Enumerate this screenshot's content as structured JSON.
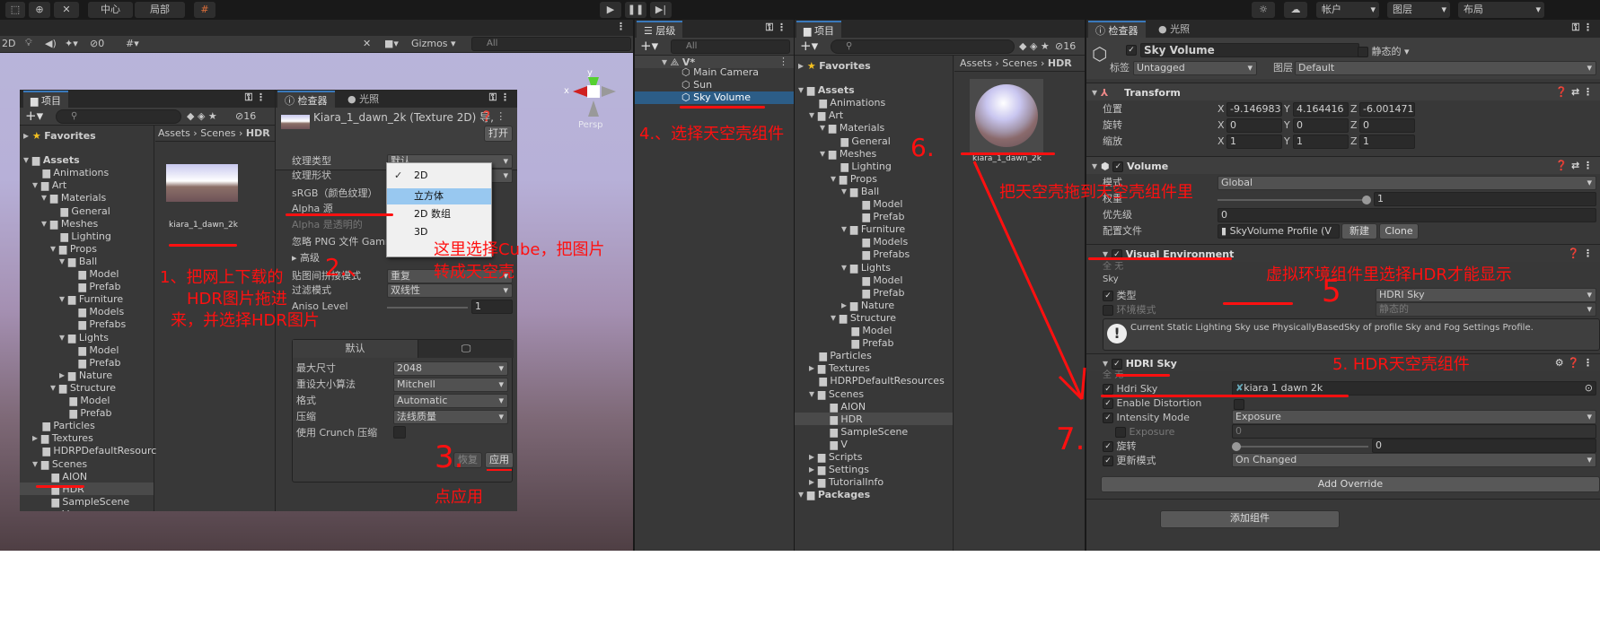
{
  "toolbar": {
    "center": "中心",
    "local": "局部",
    "account": "帐户",
    "layers": "图层",
    "layout": "布局"
  },
  "scene": {
    "mode_2d": "2D",
    "hidden_count": "0",
    "gizmos": "Gizmos",
    "search_placeholder": "All",
    "axis_x": "x",
    "axis_y": "y",
    "persp": "Persp"
  },
  "float_project": {
    "tab": "项目",
    "count": "16",
    "breadcrumb": [
      "Assets",
      "Scenes",
      "HDR"
    ],
    "asset_name": "kiara_1_dawn_2k"
  },
  "float_inspector": {
    "tab": "检查器",
    "tab2": "光照",
    "title": "Kiara_1_dawn_2k (Texture 2D) 导,",
    "open": "打开",
    "rows": [
      {
        "label": "纹理类型",
        "value": "默认"
      },
      {
        "label": "纹理形状",
        "value": "2D"
      },
      {
        "label": "sRGB（颜色纹理）"
      },
      {
        "label": "Alpha 源"
      },
      {
        "label": "Alpha 是透明的"
      },
      {
        "label": "忽略 PNG 文件 Gamma"
      },
      {
        "label": "高级"
      },
      {
        "label": "贴图间拼接模式",
        "value": "重复"
      },
      {
        "label": "过滤模式",
        "value": "双线性"
      },
      {
        "label": "Aniso Level",
        "value": "1"
      }
    ],
    "dropdown": [
      "2D",
      "立方体",
      "2D 数组",
      "3D"
    ],
    "dropdown_selected": "2D",
    "dropdown_hover": "立方体",
    "platform_tab": "默认",
    "platform_rows": [
      {
        "label": "最大尺寸",
        "value": "2048"
      },
      {
        "label": "重设大小算法",
        "value": "Mitchell"
      },
      {
        "label": "格式",
        "value": "Automatic"
      },
      {
        "label": "压缩",
        "value": "法线质量"
      },
      {
        "label": "使用 Crunch 压缩"
      }
    ],
    "revert": "恢复",
    "apply": "应用"
  },
  "hierarchy": {
    "tab": "层级",
    "search_placeholder": "All",
    "scene": "V*",
    "items": [
      "Main Camera",
      "Sun",
      "Sky Volume"
    ],
    "selected": "Sky Volume"
  },
  "project": {
    "tab": "项目",
    "count": "16",
    "breadcrumb": [
      "Assets",
      "Scenes",
      "HDR"
    ],
    "asset_name": "kiara_1_dawn_2k",
    "selected": "HDR",
    "tree": [
      [
        "Favorites",
        0,
        "fav"
      ],
      [
        "Assets",
        0,
        "root"
      ],
      [
        "Animations",
        1,
        ""
      ],
      [
        "Art",
        1,
        "o"
      ],
      [
        "Materials",
        2,
        "o"
      ],
      [
        "General",
        3,
        ""
      ],
      [
        "Meshes",
        2,
        "o"
      ],
      [
        "Lighting",
        3,
        ""
      ],
      [
        "Props",
        3,
        "o"
      ],
      [
        "Ball",
        4,
        "o"
      ],
      [
        "Model",
        5,
        ""
      ],
      [
        "Prefab",
        5,
        ""
      ],
      [
        "Furniture",
        4,
        "o"
      ],
      [
        "Models",
        5,
        ""
      ],
      [
        "Prefabs",
        5,
        ""
      ],
      [
        "Lights",
        4,
        "o"
      ],
      [
        "Model",
        5,
        ""
      ],
      [
        "Prefab",
        5,
        ""
      ],
      [
        "Nature",
        4,
        "c"
      ],
      [
        "Structure",
        3,
        "o"
      ],
      [
        "Model",
        4,
        ""
      ],
      [
        "Prefab",
        4,
        ""
      ],
      [
        "Particles",
        1,
        ""
      ],
      [
        "Textures",
        1,
        "c"
      ],
      [
        "HDRPDefaultResources",
        1,
        ""
      ],
      [
        "Scenes",
        1,
        "o"
      ],
      [
        "AION",
        2,
        ""
      ],
      [
        "HDR",
        2,
        ""
      ],
      [
        "SampleScene",
        2,
        ""
      ],
      [
        "V",
        2,
        ""
      ],
      [
        "Scripts",
        1,
        "c"
      ],
      [
        "Settings",
        1,
        "c"
      ],
      [
        "TutorialInfo",
        1,
        "c"
      ],
      [
        "Packages",
        0,
        "root"
      ]
    ]
  },
  "inspector": {
    "tab": "检查器",
    "tab2": "光照",
    "object_name": "Sky Volume",
    "static": "静态的",
    "tag_label": "标签",
    "tag": "Untagged",
    "layer_label": "图层",
    "layer": "Default",
    "transform": {
      "title": "Transform",
      "rows": [
        {
          "label": "位置",
          "x": "-9.146983",
          "y": "4.164416",
          "z": "-6.001471"
        },
        {
          "label": "旋转",
          "x": "0",
          "y": "0",
          "z": "0"
        },
        {
          "label": "缩放",
          "x": "1",
          "y": "1",
          "z": "1"
        }
      ]
    },
    "volume": {
      "title": "Volume",
      "mode_label": "模式",
      "mode": "Global",
      "weight_label": "权重",
      "weight": 1,
      "priority_label": "优先级",
      "priority": "0",
      "profile_label": "配置文件",
      "profile": "SkyVolume Profile (V",
      "new": "新建",
      "clone": "Clone"
    },
    "visual_env": {
      "title": "Visual Environment",
      "all": "全",
      "none": "无",
      "section": "Sky",
      "type_label": "类型",
      "type": "HDRI Sky",
      "ambient_label": "环境模式",
      "ambient": "静态的",
      "help": "Current Static Lighting Sky use PhysicallyBasedSky of profile Sky and Fog Settings Profile."
    },
    "hdri": {
      "title": "HDRI Sky",
      "all": "全",
      "none": "无",
      "sky_label": "Hdri Sky",
      "sky": "kiara 1 dawn 2k",
      "distortion_label": "Enable Distortion",
      "intensity_label": "Intensity Mode",
      "intensity": "Exposure",
      "exposure_label": "Exposure",
      "exposure": "0",
      "rotation_label": "旋转",
      "rotation": "0",
      "update_label": "更新模式",
      "update": "On Changed"
    },
    "add_override": "Add Override",
    "add_component": "添加组件"
  },
  "annotations": {
    "a1": "1、把网上下载的",
    "a1b": "HDR图片拖进",
    "a1c": "来，并选择HDR图片",
    "a2": "2.、",
    "a2b": "这里选择Cube，把图片",
    "a2c": "转成天空壳",
    "a3": "3.",
    "a3b": "点应用",
    "a4": "4.、选择天空壳组件",
    "a5": "虚拟环境组件里选择HDR才能显示",
    "a5b": "5",
    "a5c": "5.  HDR天空壳组件",
    "a6": "6.",
    "a6b": "把天空壳拖到天空壳组件里",
    "a7": "7."
  },
  "colors": {
    "annotation": "#ff1010",
    "selection": "#2c5d87",
    "panel": "#383838"
  }
}
